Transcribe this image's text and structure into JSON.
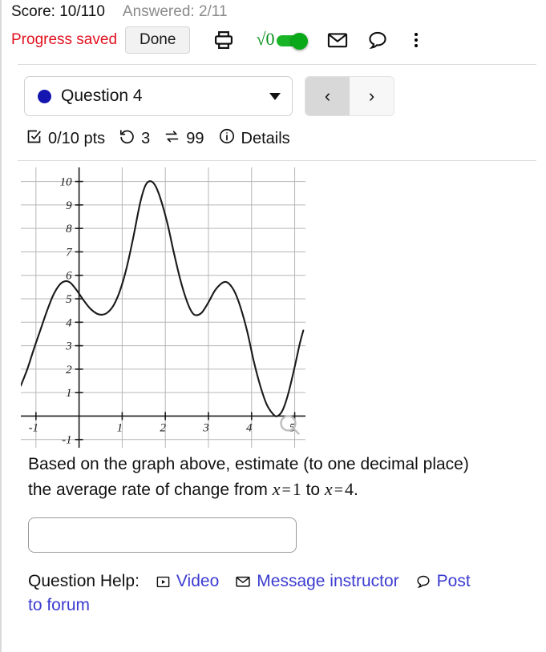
{
  "statusbar": {
    "score_label": "Score: 10/110",
    "answered_label": "Answered: 2/11"
  },
  "toolbar": {
    "progress_status": "Progress saved",
    "done_label": "Done",
    "print_icon": "print-icon",
    "sqrt_glyph": "√0",
    "math_toggle_state": "on",
    "mail_icon": "envelope-icon",
    "chat_icon": "speech-bubble-icon",
    "more_icon": "kebab-menu-icon",
    "accent_green": "#19b526",
    "accent_red": "#e1121f"
  },
  "question_selector": {
    "dot_color": "#1515b0",
    "label": "Question 4",
    "caret_icon": "chevron-down-icon",
    "prev_icon": "‹",
    "next_icon": "›"
  },
  "meta": {
    "points": "0/10 pts",
    "attempts": "3",
    "exchanges": "99",
    "details_label": "Details"
  },
  "chart_data": {
    "type": "line",
    "title": "",
    "xlabel": "",
    "ylabel": "",
    "xlim": [
      -1.35,
      5.25
    ],
    "ylim": [
      -1.35,
      10.6
    ],
    "grid": true,
    "x_ticks": [
      -1,
      1,
      2,
      3,
      4,
      5
    ],
    "y_ticks": [
      -1,
      1,
      2,
      3,
      4,
      5,
      6,
      7,
      8,
      9,
      10
    ],
    "legend": "none",
    "annotations": [
      "magnifier-icon near x=5 on x-axis"
    ],
    "points": [
      [
        -1.35,
        1.3
      ],
      [
        -1.2,
        2.0
      ],
      [
        -1.05,
        2.85
      ],
      [
        -0.9,
        3.65
      ],
      [
        -0.75,
        4.45
      ],
      [
        -0.6,
        5.15
      ],
      [
        -0.45,
        5.6
      ],
      [
        -0.32,
        5.75
      ],
      [
        -0.2,
        5.68
      ],
      [
        -0.05,
        5.35
      ],
      [
        0.1,
        4.95
      ],
      [
        0.25,
        4.6
      ],
      [
        0.4,
        4.38
      ],
      [
        0.52,
        4.32
      ],
      [
        0.65,
        4.4
      ],
      [
        0.8,
        4.72
      ],
      [
        0.95,
        5.35
      ],
      [
        1.1,
        6.3
      ],
      [
        1.25,
        7.55
      ],
      [
        1.4,
        8.95
      ],
      [
        1.5,
        9.65
      ],
      [
        1.58,
        9.95
      ],
      [
        1.68,
        10.0
      ],
      [
        1.78,
        9.78
      ],
      [
        1.9,
        9.2
      ],
      [
        2.05,
        8.2
      ],
      [
        2.2,
        6.95
      ],
      [
        2.35,
        5.8
      ],
      [
        2.5,
        4.9
      ],
      [
        2.62,
        4.42
      ],
      [
        2.72,
        4.3
      ],
      [
        2.85,
        4.42
      ],
      [
        3.0,
        4.85
      ],
      [
        3.15,
        5.35
      ],
      [
        3.3,
        5.65
      ],
      [
        3.4,
        5.72
      ],
      [
        3.5,
        5.6
      ],
      [
        3.62,
        5.25
      ],
      [
        3.75,
        4.6
      ],
      [
        3.9,
        3.6
      ],
      [
        4.05,
        2.35
      ],
      [
        4.2,
        1.3
      ],
      [
        4.35,
        0.5
      ],
      [
        4.5,
        0.08
      ],
      [
        4.6,
        0.0
      ],
      [
        4.72,
        0.25
      ],
      [
        4.85,
        0.95
      ],
      [
        5.0,
        2.1
      ],
      [
        5.12,
        3.1
      ],
      [
        5.2,
        3.65
      ]
    ],
    "key_values": {
      "at_x_1": 5.6,
      "at_x_4": 2.5,
      "local_max_1": {
        "x": -0.32,
        "y": 5.75
      },
      "local_min_1": {
        "x": 0.52,
        "y": 4.32
      },
      "global_max": {
        "x": 1.68,
        "y": 10.0
      },
      "local_min_2": {
        "x": 2.72,
        "y": 4.3
      },
      "local_max_2": {
        "x": 3.4,
        "y": 5.72
      },
      "global_min": {
        "x": 4.6,
        "y": 0.0
      }
    }
  },
  "prompt": {
    "line1": "Based on the graph above, estimate (to one decimal place)",
    "line2_a": "the average rate of change from ",
    "eq1_var": "x",
    "eq1_rel": "=",
    "eq1_val": "1",
    "line2_b": " to ",
    "eq2_var": "x",
    "eq2_rel": "=",
    "eq2_val": "4",
    "line2_c": "."
  },
  "answer": {
    "value": "",
    "placeholder": ""
  },
  "help": {
    "label": "Question Help:",
    "video_label": "Video",
    "video_icon": "play-box-icon",
    "message_label": "Message instructor",
    "message_icon": "envelope-icon",
    "post_label": "Post",
    "post_label2": "to forum",
    "post_icon": "speech-bubble-icon",
    "link_color": "#3b3bd0"
  }
}
